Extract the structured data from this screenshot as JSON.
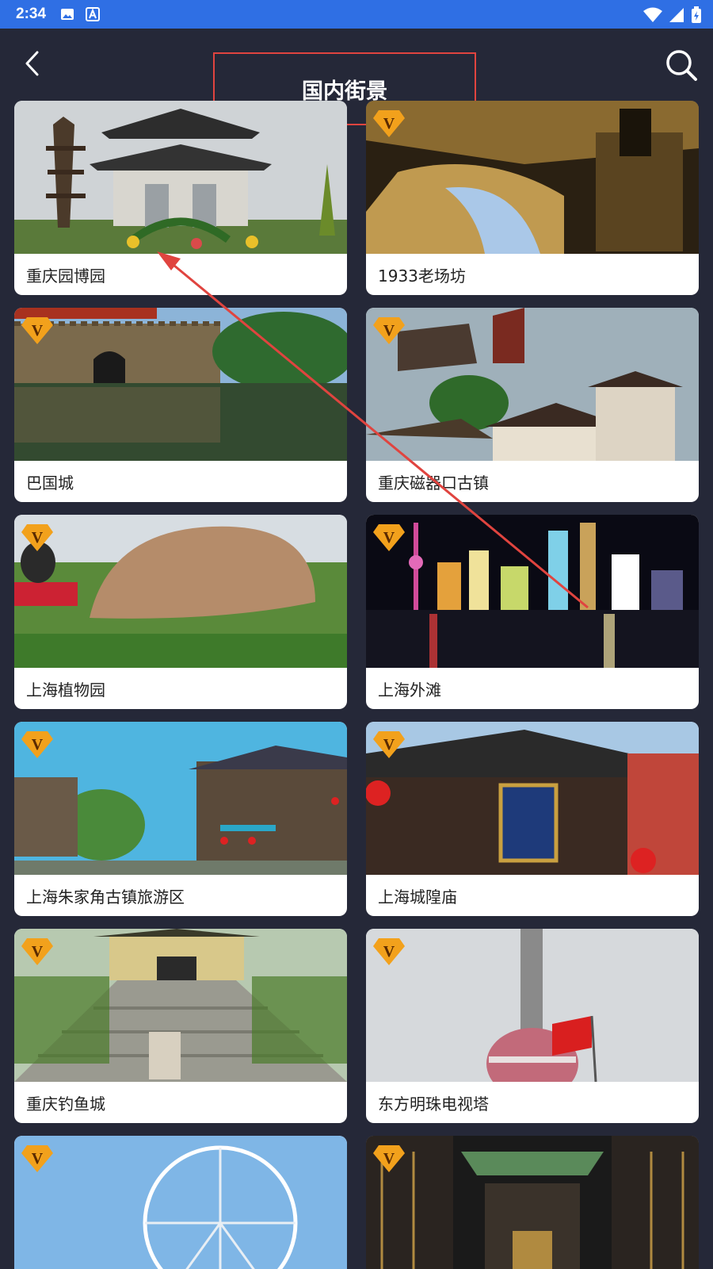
{
  "status_bar": {
    "time": "2:34"
  },
  "header": {
    "title": "国内街景"
  },
  "vip_badge_text": "V",
  "cards": [
    {
      "label": "重庆园博园",
      "vip": false,
      "scene": "pagoda-gate"
    },
    {
      "label": "1933老场坊",
      "vip": true,
      "scene": "warehouse"
    },
    {
      "label": "巴国城",
      "vip": true,
      "scene": "wall-reflection"
    },
    {
      "label": "重庆磁器口古镇",
      "vip": true,
      "scene": "old-town"
    },
    {
      "label": "上海植物园",
      "vip": true,
      "scene": "stone"
    },
    {
      "label": "上海外滩",
      "vip": true,
      "scene": "night-skyline"
    },
    {
      "label": "上海朱家角古镇旅游区",
      "vip": true,
      "scene": "water-town"
    },
    {
      "label": "上海城隍庙",
      "vip": true,
      "scene": "temple"
    },
    {
      "label": "重庆钓鱼城",
      "vip": true,
      "scene": "stairs"
    },
    {
      "label": "东方明珠电视塔",
      "vip": true,
      "scene": "tower"
    },
    {
      "label": "",
      "vip": true,
      "scene": "ferris-wheel"
    },
    {
      "label": "",
      "vip": true,
      "scene": "courtyard"
    }
  ],
  "colors": {
    "status_bar": "#2f6fe4",
    "background": "#252838",
    "annotation": "#e0443f",
    "vip_badge": "#f2a11c"
  }
}
